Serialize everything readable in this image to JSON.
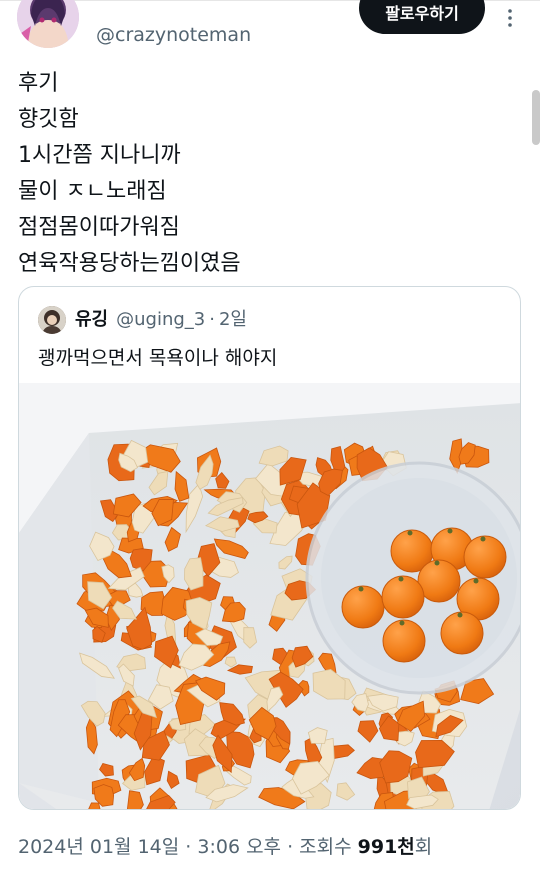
{
  "author": {
    "display_name": "· ·· · ···",
    "handle": "@crazynoteman",
    "follow_label": "팔로우하기",
    "avatar_icon": "anime-avatar-icon"
  },
  "tweet": {
    "lines": [
      "후기",
      "향깃함",
      "1시간쯤 지나니까",
      "물이 ㅈㄴ노래짐",
      "점점몸이따가워짐",
      "연육작용당하는낌이였음"
    ]
  },
  "quote": {
    "name": "유깅",
    "handle": "@uging_3",
    "separator": "·",
    "time": "2일",
    "text": "괭까먹으면서 목욕이나 해야지",
    "photo_icon": "tangerine-bath-photo"
  },
  "meta": {
    "date": "2024년 01월 14일",
    "sep1": " · ",
    "time": "3:06 오후",
    "sep2": " · ",
    "views_label": "조회수 ",
    "views_count": "991천",
    "views_suffix": "회"
  },
  "colors": {
    "text": "#0f1419",
    "secondary": "#536471",
    "border": "#cfd9de",
    "button": "#0f1419"
  }
}
